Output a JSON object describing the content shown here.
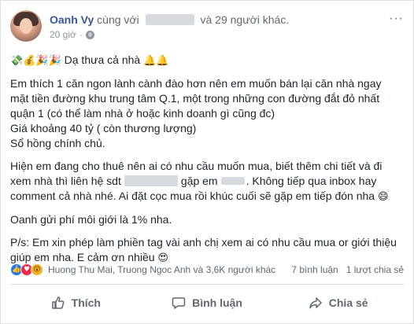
{
  "post": {
    "author": "Oanh Vy",
    "with_text": "cùng với",
    "others_text": "và 29 người khác.",
    "time": "20 giờ",
    "more_label": "···"
  },
  "content": {
    "greeting": "Dạ thưa cả nhà",
    "para1": [
      "Em thích 1 căn ngon lành cành đào hơn nên em muốn bán lại căn nhà ngay",
      "mặt tiền đường khu trung tâm Q.1, một trong những con đường đắt đỏ nhất",
      "quận 1 (có thể làm nhà ở hoặc kinh doanh gì cũng đc)",
      "Giá khoảng 40 tỷ ( còn thương lượng)",
      "Sổ hồng chính chủ."
    ],
    "para2_line1": "Hiện em đang cho thuê nên ai có nhu cầu muốn mua, biết thêm chi tiết và đi",
    "para2_line2_a": "xem nhà thì liên hệ sdt",
    "para2_line2_b": "gặp em",
    "para2_line2_c": ". Không tiếp qua inbox hay",
    "para2_line3": "comment cả nhà nhé. Ai đặt cọc mua rồi khúc cuối sẽ gặp em tiếp đón nha",
    "para3": "Oanh gửi phí môi giới là 1% nha.",
    "para4_line1": "P/s: Em xin phép làm phiền tag vài anh chị xem ai có nhu cầu mua or giới thiệu",
    "para4_line2": "giúp em nha. E cảm ơn nhiều"
  },
  "reactions": {
    "summary": "Huong Thu Mai, Truong Ngoc Anh và 3,6K người khác",
    "comments": "7 bình luận",
    "shares": "1 lượt chia sẻ"
  },
  "actions": {
    "like": "Thích",
    "comment": "Bình luận",
    "share": "Chia sẻ"
  },
  "colors": {
    "author": "#385898",
    "muted": "#606770",
    "like_blue": "#2078f4",
    "love_red": "#f0284a",
    "wow_yellow": "#f7b125"
  }
}
